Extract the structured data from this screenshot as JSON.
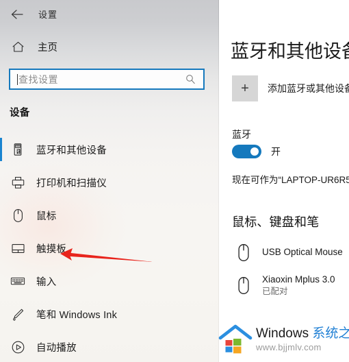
{
  "window": {
    "title": "设置",
    "back_icon": "back-arrow-icon"
  },
  "sidebar": {
    "home": {
      "label": "主页",
      "icon": "home-icon"
    },
    "search": {
      "placeholder": "查找设置",
      "icon": "search-icon",
      "value": ""
    },
    "section_heading": "设备",
    "items": [
      {
        "label": "蓝牙和其他设备",
        "icon": "bluetooth-device-icon",
        "selected": true
      },
      {
        "label": "打印机和扫描仪",
        "icon": "printer-icon",
        "selected": false
      },
      {
        "label": "鼠标",
        "icon": "mouse-icon",
        "selected": false
      },
      {
        "label": "触摸板",
        "icon": "touchpad-icon",
        "selected": false
      },
      {
        "label": "输入",
        "icon": "keyboard-icon",
        "selected": false
      },
      {
        "label": "笔和 Windows Ink",
        "icon": "pen-icon",
        "selected": false
      },
      {
        "label": "自动播放",
        "icon": "autoplay-icon",
        "selected": false
      }
    ]
  },
  "annotation": {
    "arrow_color": "#e8241c",
    "points_at": "触摸板"
  },
  "main": {
    "title": "蓝牙和其他设备",
    "add_device": {
      "label": "添加蓝牙或其他设备",
      "icon": "plus-icon"
    },
    "bluetooth": {
      "label": "蓝牙",
      "toggle_state": "开",
      "toggle_on": true,
      "toggle_color": "#1579bd",
      "discoverable_text": "现在可作为“LAPTOP-UR6R5"
    },
    "devices_section": {
      "heading": "鼠标、键盘和笔",
      "devices": [
        {
          "name": "USB Optical Mouse",
          "status": "",
          "icon": "mouse-icon"
        },
        {
          "name": "Xiaoxin Mplus 3.0",
          "status": "已配对",
          "icon": "mouse-icon"
        }
      ]
    }
  },
  "watermark": {
    "brand_en": "Windows ",
    "brand_cn": "系统之家",
    "url": "www.bjjmlv.com",
    "icon": "windows-house-logo"
  }
}
